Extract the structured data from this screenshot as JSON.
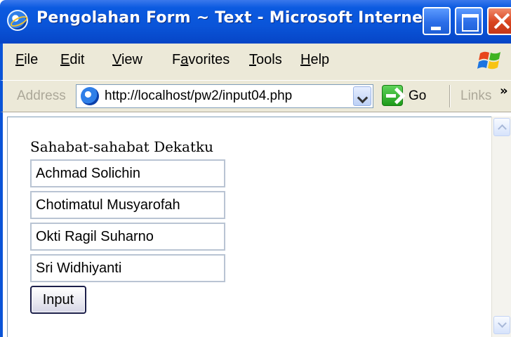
{
  "window": {
    "title": "Pengolahan Form ~ Text - Microsoft Interne..."
  },
  "menubar": {
    "items": [
      {
        "label": "File",
        "access_key": "F"
      },
      {
        "label": "Edit",
        "access_key": "E"
      },
      {
        "label": "View",
        "access_key": "V"
      },
      {
        "label": "Favorites",
        "access_key": "a"
      },
      {
        "label": "Tools",
        "access_key": "T"
      },
      {
        "label": "Help",
        "access_key": "H"
      }
    ]
  },
  "addressbar": {
    "label": "Address",
    "url": "http://localhost/pw2/input04.php",
    "go_label": "Go",
    "links_label": "Links",
    "chevron": "»"
  },
  "page": {
    "heading": "Sahabat-sahabat Dekatku",
    "inputs": [
      {
        "value": "Achmad Solichin"
      },
      {
        "value": "Chotimatul Musyarofah"
      },
      {
        "value": "Okti Ragil Suharno"
      },
      {
        "value": "Sri Widhiyanti"
      }
    ],
    "submit_label": "Input"
  },
  "colors": {
    "titlebar": "#0a54d8",
    "chrome": "#ece9d8",
    "close_button": "#d8431e"
  }
}
